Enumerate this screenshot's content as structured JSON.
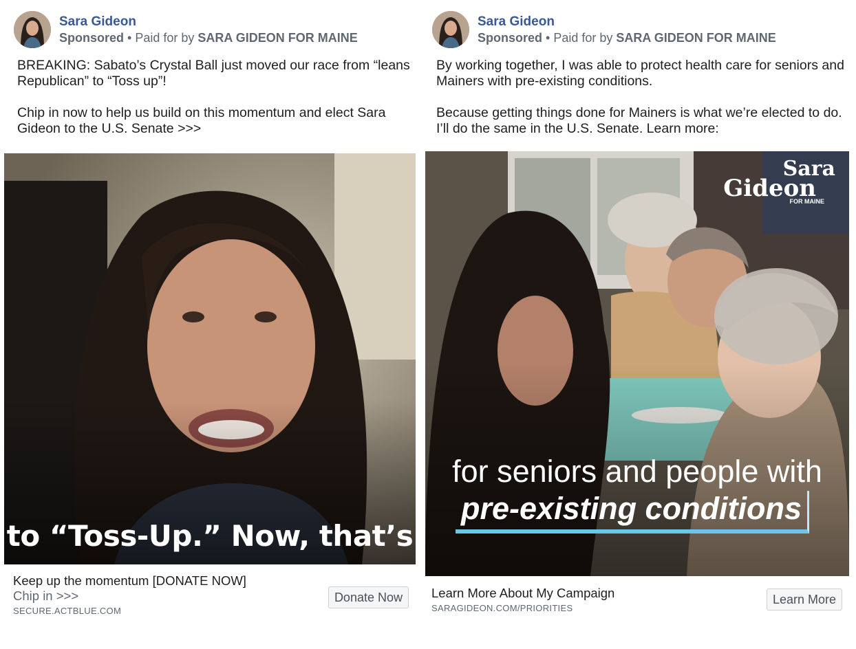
{
  "ads": [
    {
      "page_name": "Sara Gideon",
      "sponsored_label": "Sponsored",
      "separator": "•",
      "paid_for_prefix": "Paid for by",
      "paid_for_by": "SARA GIDEON FOR MAINE",
      "body": [
        "BREAKING: Sabato’s Crystal Ball just moved our race from “leans Republican” to “Toss up”!",
        "Chip in now to help us build on this momentum and elect Sara Gideon to the U.S. Senate >>>"
      ],
      "media_caption": "to “Toss-Up.” Now, that’s",
      "link_title": "Keep up the momentum [DONATE NOW]",
      "link_description": "Chip in >>>",
      "link_domain": "SECURE.ACTBLUE.COM",
      "cta_label": "Donate Now"
    },
    {
      "page_name": "Sara Gideon",
      "sponsored_label": "Sponsored",
      "separator": "•",
      "paid_for_prefix": "Paid for by",
      "paid_for_by": "SARA GIDEON FOR MAINE",
      "body": [
        "By working together, I was able to protect health care for seniors and Mainers with pre-existing conditions.",
        "Because getting things done for Mainers is what we’re elected to do. I’ll do the same in the U.S. Senate. Learn more:"
      ],
      "media_caption_line1": "for seniors and people with",
      "media_caption_line2": "pre-existing conditions",
      "brand_line1": "Sara",
      "brand_line2": "Gideon",
      "brand_line3": "FOR MAINE",
      "link_title": "Learn More About My Campaign",
      "link_domain": "SARAGIDEON.COM/PRIORITIES",
      "cta_label": "Learn More"
    }
  ],
  "colors": {
    "page_name": "#385898",
    "secondary_text": "#606770",
    "caption_underline": "#6ec4e8"
  }
}
